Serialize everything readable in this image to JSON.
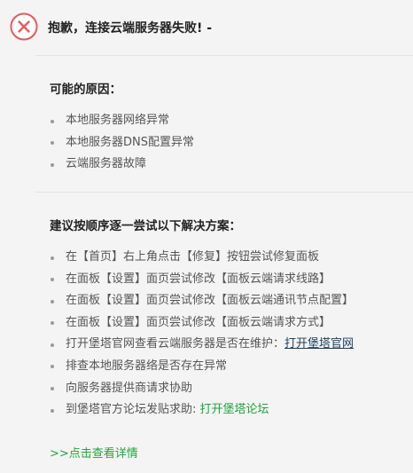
{
  "header": {
    "title": "抱歉，连接云端服务器失败! -",
    "icon": "error-x-circle-icon",
    "icon_color": "#e35b5b"
  },
  "causes": {
    "title": "可能的原因：",
    "items": [
      "本地服务器网络异常",
      "本地服务器DNS配置异常",
      "云端服务器故障"
    ]
  },
  "solutions": {
    "title": "建议按顺序逐一尝试以下解决方案：",
    "items": [
      {
        "text": "在【首页】右上角点击【修复】按钮尝试修复面板"
      },
      {
        "text": "在面板【设置】面页尝试修改【面板云端请求线路】"
      },
      {
        "text": "在面板【设置】面页尝试修改【面板云端通讯节点配置】"
      },
      {
        "text": "在面板【设置】面页尝试修改【面板云端请求方式】"
      },
      {
        "text": "打开堡塔官网查看云端服务器是否在维护：",
        "link": "打开堡塔官网"
      },
      {
        "text": "排查本地服务器络是否存在异常"
      },
      {
        "text": "向服务器提供商请求协助"
      },
      {
        "text": "到堡塔官方论坛发贴求助: ",
        "link": "打开堡塔论坛"
      }
    ]
  },
  "details_link": ">>点击查看详情",
  "colors": {
    "accent_green": "#20a53a",
    "link_dark": "#20415d",
    "error_red": "#e35b5b"
  }
}
